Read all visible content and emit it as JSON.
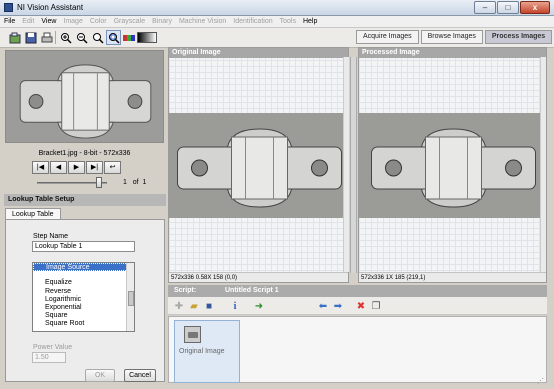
{
  "window": {
    "title": "NI Vision Assistant",
    "buttons": {
      "minimize": "–",
      "maximize": "□",
      "close": "x"
    }
  },
  "menubar": {
    "items": [
      {
        "label": "File",
        "enabled": true
      },
      {
        "label": "Edit",
        "enabled": false
      },
      {
        "label": "View",
        "enabled": true
      },
      {
        "label": "Image",
        "enabled": false
      },
      {
        "label": "Color",
        "enabled": false
      },
      {
        "label": "Grayscale",
        "enabled": false
      },
      {
        "label": "Binary",
        "enabled": false
      },
      {
        "label": "Machine Vision",
        "enabled": false
      },
      {
        "label": "Identification",
        "enabled": false
      },
      {
        "label": "Tools",
        "enabled": false
      },
      {
        "label": "Help",
        "enabled": true
      }
    ]
  },
  "toolbar": {
    "icons": [
      "acquire-icon",
      "save-icon",
      "print-icon",
      "selection-arrow-icon",
      "zoom-in-icon",
      "zoom-out-icon",
      "zoom-1to1-icon",
      "zoom-fit-icon",
      "color-palette-icon",
      "lookup-table-icon"
    ]
  },
  "mode_tabs": [
    {
      "label": "Acquire Images",
      "active": false
    },
    {
      "label": "Browse Images",
      "active": false
    },
    {
      "label": "Process Images",
      "active": true
    }
  ],
  "browser": {
    "filename": "Bracket1.jpg - 8-bit - 572x336",
    "nav": [
      "|◀",
      "◀",
      "▶",
      "▶|",
      "↩"
    ],
    "page": {
      "current": "1",
      "of_label": "of",
      "total": "1"
    }
  },
  "setup": {
    "header": "Lookup Table Setup",
    "tab": "Lookup Table",
    "step_name_label": "Step Name",
    "step_name_value": "Lookup Table 1",
    "list": {
      "items": [
        "Image Source",
        "",
        "Equalize",
        "Reverse",
        "Logarithmic",
        "Exponential",
        "Square",
        "Square Root"
      ],
      "selected": "Image Source"
    },
    "power_label": "Power Value",
    "power_value": "1.50",
    "ok": "OK",
    "cancel": "Cancel"
  },
  "panes": {
    "original": {
      "header": "Original Image",
      "status": "572x336 0.58X 158    (0,0)"
    },
    "processed": {
      "header": "Processed Image",
      "status": "572x336 1X 185    (219,1)"
    }
  },
  "script": {
    "label": "Script:",
    "name": "Untitled Script 1",
    "steps": [
      {
        "label": "Original Image"
      }
    ],
    "tools": [
      "new-step-icon",
      "open-script-icon",
      "save-script-icon",
      "info-icon",
      "run-once-icon",
      "move-left-icon",
      "move-right-icon",
      "delete-step-icon",
      "copy-step-icon"
    ]
  },
  "colors": {
    "accent": "#3a70c8",
    "header_gray": "#a7a7a7"
  }
}
